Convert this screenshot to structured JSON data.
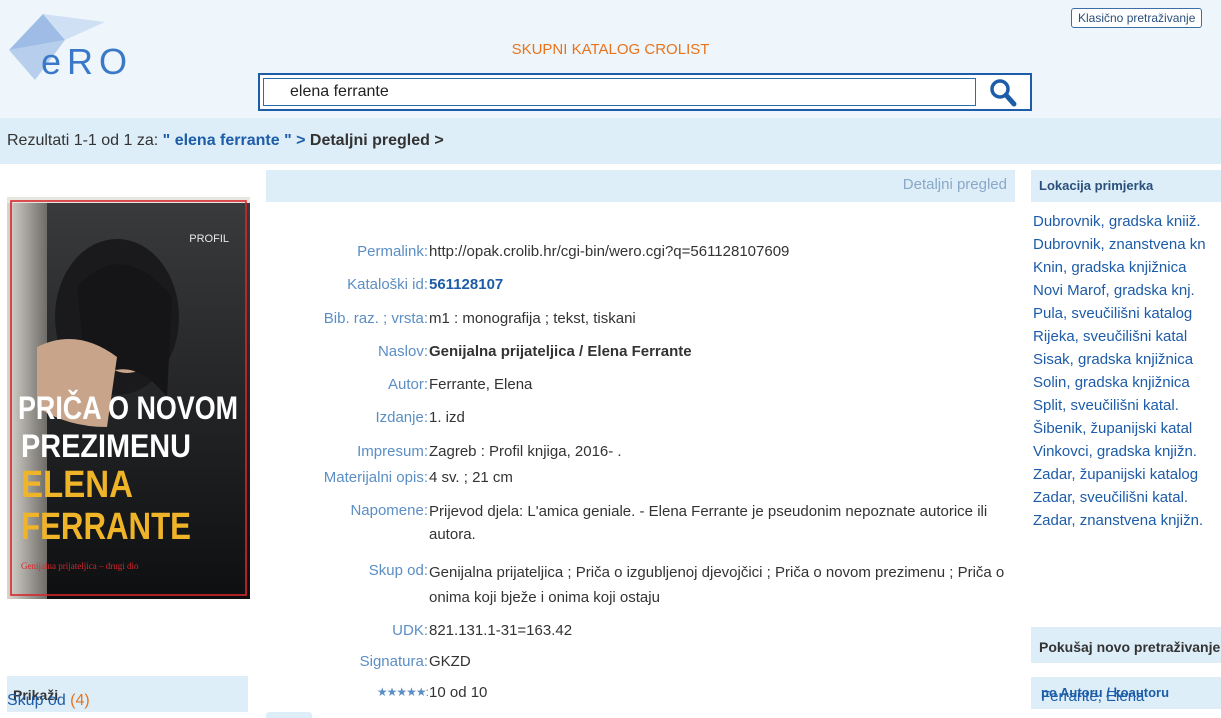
{
  "header": {
    "logo_text": "eRO",
    "catalog_title": "SKUPNI KATALOG CROLIST",
    "classic_search_label": "Klasično pretraživanje"
  },
  "search": {
    "value": "elena ferrante",
    "icon": "search-icon"
  },
  "breadcrumb": {
    "prefix": "Rezultati 1-1 od 1 za:",
    "query": "\" elena ferrante \"",
    "sep1": " > ",
    "detail": "Detaljni pregled",
    "sep2": " >"
  },
  "cover": {
    "publisher": "PROFIL",
    "title_line1": "PRIČA O NOVOM",
    "title_line2": "PREZIMENU",
    "author_line1": "ELENA",
    "author_line2": "FERRANTE",
    "subtitle": "Genijalna prijateljica – drugi dio"
  },
  "left_panel": {
    "prikazi_label": "Prikaži",
    "skup_label": "Skup od",
    "skup_count": "(4)"
  },
  "detail": {
    "header_label": "Detaljni pregled",
    "fields": [
      {
        "label": "Permalink:",
        "value": "http://opak.crolib.hr/cgi-bin/wero.cgi?q=561128107609"
      },
      {
        "label": "Kataloški id:",
        "value": "561128107"
      },
      {
        "label": "Bib. raz. ; vrsta:",
        "value": "m1 : monografija ; tekst, tiskani"
      },
      {
        "label": "Naslov:",
        "value": "Genijalna prijateljica / Elena Ferrante"
      },
      {
        "label": "Autor:",
        "value": "Ferrante, Elena"
      },
      {
        "label": "Izdanje:",
        "value": "1. izd"
      },
      {
        "label": "Impresum:",
        "value": "Zagreb : Profil knjiga, 2016- ."
      },
      {
        "label": "Materijalni opis:",
        "value": "4 sv. ; 21 cm"
      },
      {
        "label": "Napomene:",
        "value": "Prijevod djela: L'amica geniale. - Elena Ferrante je pseudonim nepoznate autorice ili autora."
      },
      {
        "label": "Skup od:",
        "value": "Genijalna prijateljica ; Priča o izgubljenoj djevojčici ; Priča o novom prezimenu ; Priča o onima koji bježe i onima koji ostaju"
      },
      {
        "label": "UDK:",
        "value": "821.131.1-31=163.42"
      },
      {
        "label": "Signatura:",
        "value": "GKZD"
      },
      {
        "label": "★★★★★:",
        "value": "10 od 10",
        "stars": 5
      }
    ]
  },
  "right_panel": {
    "location_title": "Lokacija primjerka",
    "locations": [
      "Dubrovnik, gradska kniiž.",
      "Dubrovnik, znanstvena kn",
      "Knin, gradska knjižnica",
      "Novi Marof, gradska knj.",
      "Pula, sveučilišni katalog",
      "Rijeka, sveučilišni katal",
      "Sisak, gradska knjižnica",
      "Solin, gradska knjižnica",
      "Split, sveučilišni katal.",
      "Šibenik, županijski katal",
      "Vinkovci, gradska knjižn.",
      "Zadar, županijski katalog",
      "Zadar, sveučilišni katal.",
      "Zadar, znanstvena knjižn."
    ],
    "new_search_title": "Pokušaj novo pretraživanje",
    "by_author_title": "po Autoru / koautoru",
    "author": "Ferrante, Elena"
  },
  "colors": {
    "accent_orange": "#e8731b",
    "link_blue": "#1d5ca8",
    "label_blue": "#5b8ec4",
    "panel_bg": "#ddeef9"
  }
}
